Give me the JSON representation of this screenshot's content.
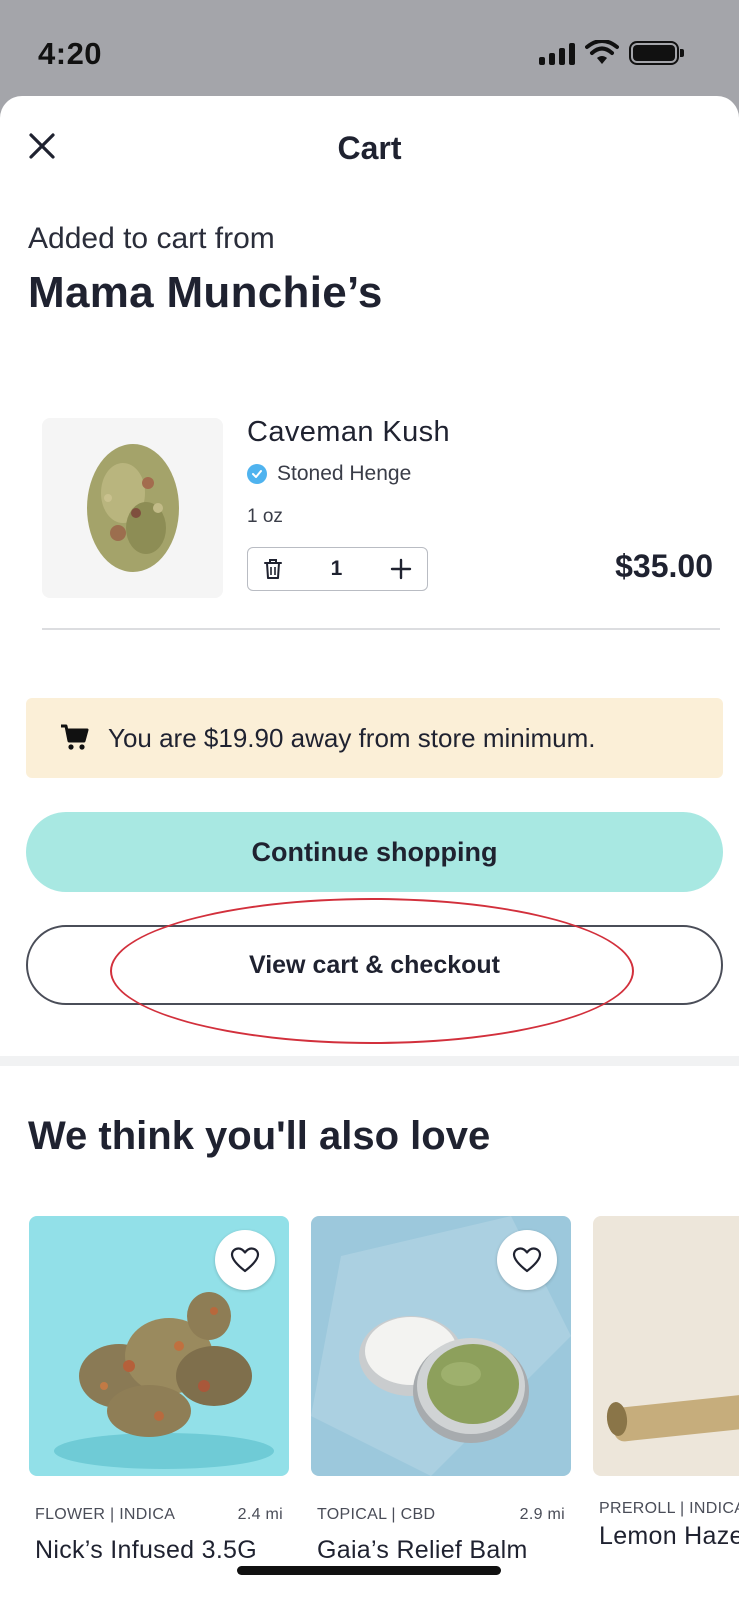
{
  "status_bar": {
    "time": "4:20"
  },
  "header": {
    "title": "Cart"
  },
  "store": {
    "added_label": "Added to cart from",
    "name": "Mama Munchie’s"
  },
  "cart_item": {
    "name": "Caveman Kush",
    "brand": "Stoned Henge",
    "size": "1 oz",
    "quantity": "1",
    "price": "$35.00"
  },
  "minimum_notice": {
    "text": "You are $19.90 away from store minimum."
  },
  "actions": {
    "continue_label": "Continue shopping",
    "checkout_label": "View cart & checkout"
  },
  "recommendations": {
    "title": "We think you'll also love",
    "items": [
      {
        "category": "FLOWER | INDICA",
        "distance": "2.4 mi",
        "name": "Nick’s Infused 3.5G"
      },
      {
        "category": "TOPICAL | CBD",
        "distance": "2.9 mi",
        "name": "Gaia’s Relief Balm"
      },
      {
        "category": "PREROLL | INDICA",
        "distance": "",
        "name": "Lemon Haze"
      }
    ]
  },
  "colors": {
    "accent_teal": "#a8e8e2",
    "banner_bg": "#fbefd7",
    "annotation_red": "#d2303c",
    "verified_blue": "#4fb3ef"
  }
}
